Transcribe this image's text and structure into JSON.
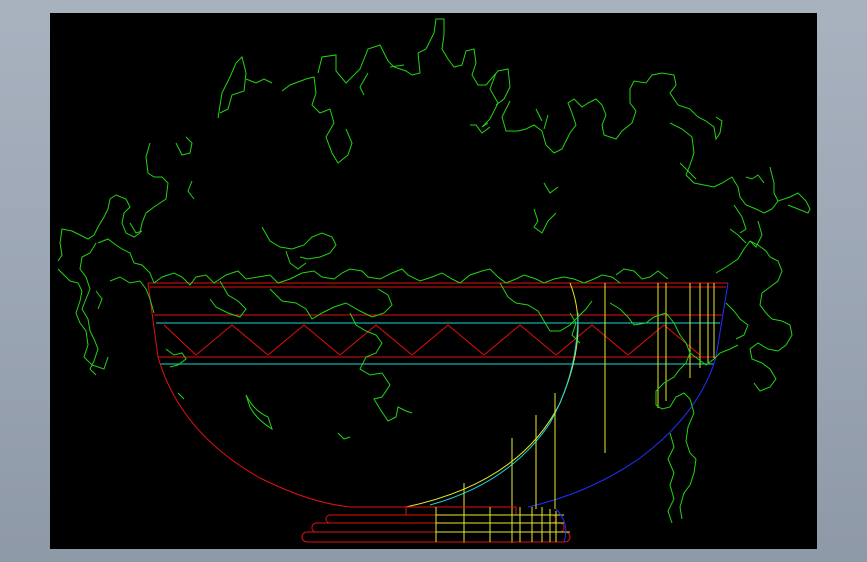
{
  "viewer": {
    "background": "#000000",
    "frame_color": "#9aa5b3"
  },
  "drawing": {
    "subject": "planter-bowl-with-foliage",
    "layer_colors": {
      "foliage": "#22d414",
      "bowl_outline": "#e01010",
      "bands": "#e01010",
      "inner_band": "#18d8d8",
      "construction_lines": "#e8e82a",
      "right_profile": "#2030ff"
    }
  }
}
